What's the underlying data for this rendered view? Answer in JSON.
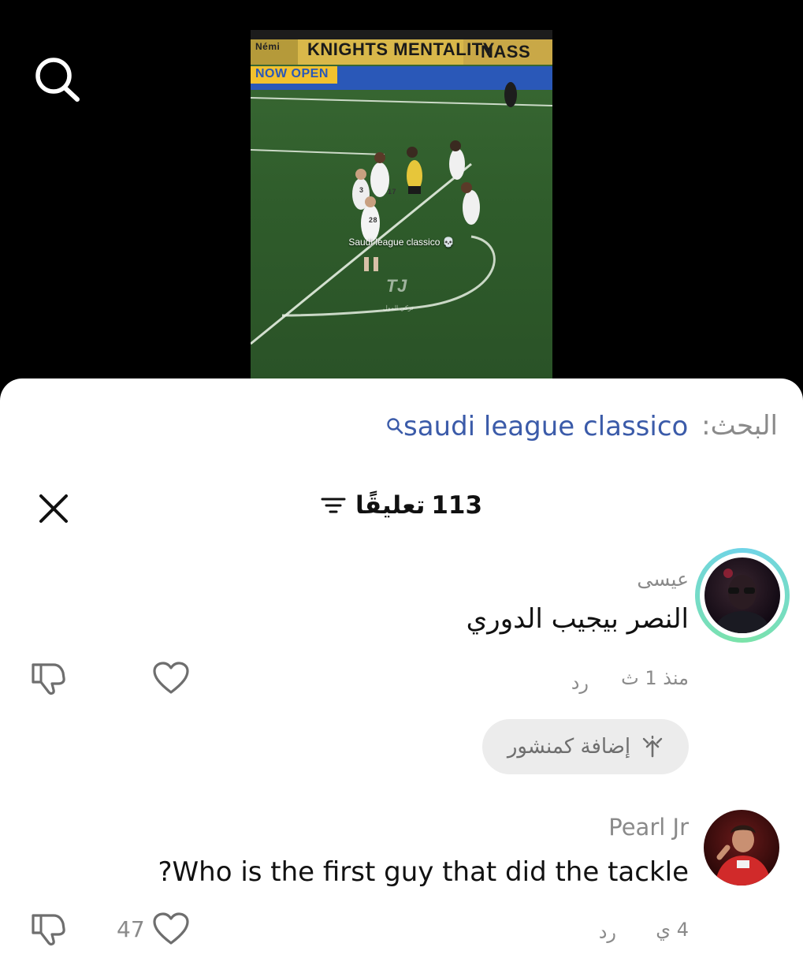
{
  "video": {
    "banner_text": "KNIGHTS MENTALITY",
    "banner_text_right": "NASS",
    "banner_small_left": "Némi",
    "ad_text": "NOW OPEN",
    "caption": "Saudi league classico 💀",
    "watermark": "TJ",
    "watermark_sub": "تركي المول",
    "player_numbers": [
      "17",
      "3",
      "28"
    ]
  },
  "search": {
    "label": "البحث:",
    "query": "saudi league classico"
  },
  "header": {
    "count": "113",
    "count_label": "تعليقًا"
  },
  "comments": [
    {
      "username": "عيسى",
      "text": "النصر بيجيب الدوري",
      "time": "منذ 1 ث",
      "reply_label": "رد",
      "likes": "",
      "repost_label": "إضافة كمنشور"
    },
    {
      "username": "Pearl Jr",
      "text": "?Who is the first guy that did the tackle",
      "time": "4 ي",
      "reply_label": "رد",
      "likes": "47"
    }
  ],
  "icons": {
    "search": "search-icon",
    "close": "close-icon",
    "sort": "sort-icon",
    "like": "heart-icon",
    "dislike": "thumbs-down-icon",
    "repost": "repost-icon"
  },
  "colors": {
    "search_query": "#3b5ba9",
    "muted": "#8a8a8a",
    "story_ring_a": "#6fd3e8",
    "story_ring_b": "#7be3a8"
  }
}
